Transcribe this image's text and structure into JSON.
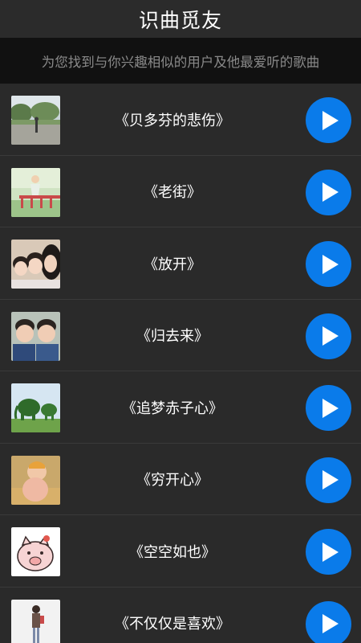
{
  "header": {
    "title": "识曲觅友"
  },
  "subtitle": "为您找到与你兴趣相似的用户及他最爱听的歌曲",
  "colors": {
    "accent": "#0a7bea",
    "background": "#2a2a2a",
    "subtitle_bar": "#111111"
  },
  "songs": [
    {
      "title": "《贝多芬的悲伤》",
      "thumbnail": "park-photo",
      "play_icon": "play-icon"
    },
    {
      "title": "《老街》",
      "thumbnail": "girl-on-bridge-illustration",
      "play_icon": "play-icon"
    },
    {
      "title": "《放开》",
      "thumbnail": "family-selfie",
      "play_icon": "play-icon"
    },
    {
      "title": "《归去来》",
      "thumbnail": "two-boys-photo",
      "play_icon": "play-icon"
    },
    {
      "title": "《追梦赤子心》",
      "thumbnail": "elephant-topiary-photo",
      "play_icon": "play-icon"
    },
    {
      "title": "《穷开心》",
      "thumbnail": "baby-photo",
      "play_icon": "play-icon"
    },
    {
      "title": "《空空如也》",
      "thumbnail": "pig-cartoon",
      "play_icon": "play-icon"
    },
    {
      "title": "《不仅仅是喜欢》",
      "thumbnail": "person-standing-photo",
      "play_icon": "play-icon"
    }
  ]
}
